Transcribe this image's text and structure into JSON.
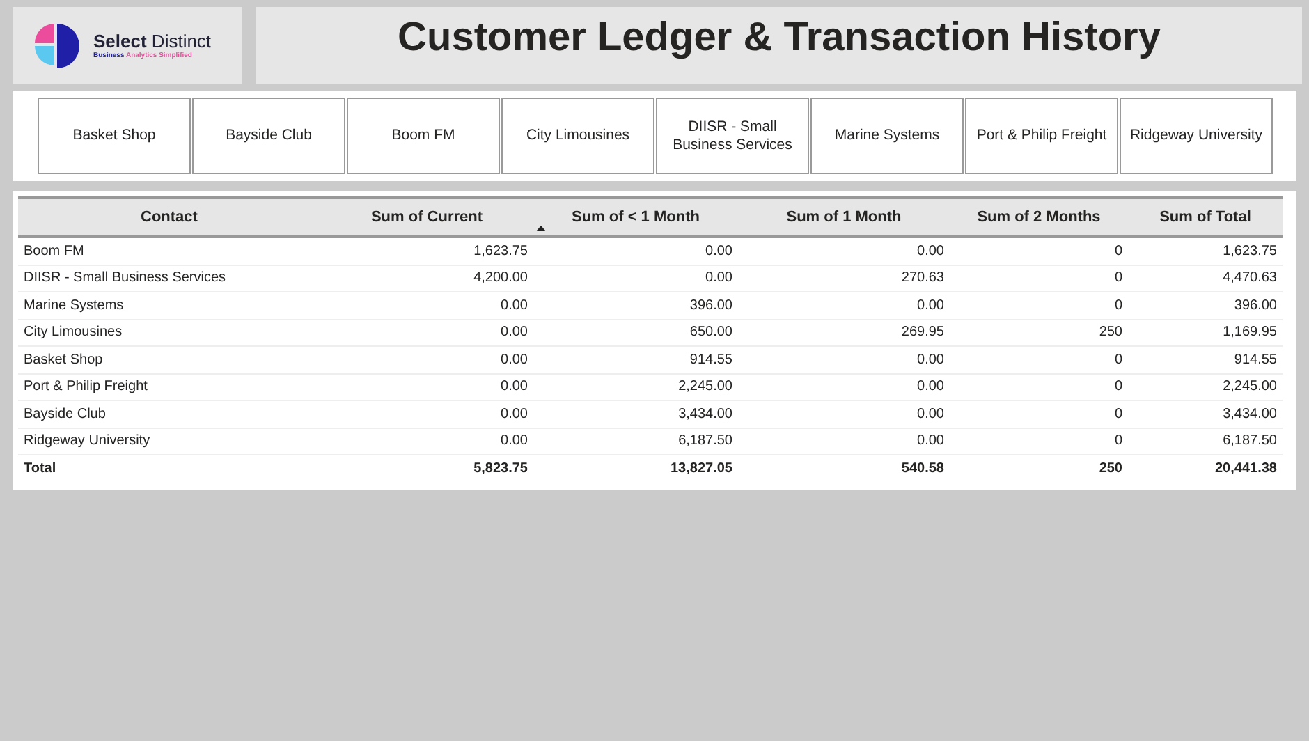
{
  "logo": {
    "name_bold": "Select",
    "name_rest": "Distinct",
    "tagline_a": "Business",
    "tagline_b": "Analytics Simplified"
  },
  "title": "Customer Ledger & Transaction History",
  "slicer": [
    "Basket Shop",
    "Bayside Club",
    "Boom FM",
    "City Limousines",
    "DIISR - Small Business Services",
    "Marine Systems",
    "Port & Philip Freight",
    "Ridgeway University"
  ],
  "table": {
    "columns": [
      {
        "label": "Contact",
        "sorted": false
      },
      {
        "label": "Sum of Current",
        "sorted": false
      },
      {
        "label": "Sum of < 1 Month",
        "sorted": true
      },
      {
        "label": "Sum of 1 Month",
        "sorted": false
      },
      {
        "label": "Sum of 2 Months",
        "sorted": false
      },
      {
        "label": "Sum of Total",
        "sorted": false
      }
    ],
    "rows": [
      [
        "Boom FM",
        "1,623.75",
        "0.00",
        "0.00",
        "0",
        "1,623.75"
      ],
      [
        "DIISR - Small Business Services",
        "4,200.00",
        "0.00",
        "270.63",
        "0",
        "4,470.63"
      ],
      [
        "Marine Systems",
        "0.00",
        "396.00",
        "0.00",
        "0",
        "396.00"
      ],
      [
        "City Limousines",
        "0.00",
        "650.00",
        "269.95",
        "250",
        "1,169.95"
      ],
      [
        "Basket Shop",
        "0.00",
        "914.55",
        "0.00",
        "0",
        "914.55"
      ],
      [
        "Port & Philip Freight",
        "0.00",
        "2,245.00",
        "0.00",
        "0",
        "2,245.00"
      ],
      [
        "Bayside Club",
        "0.00",
        "3,434.00",
        "0.00",
        "0",
        "3,434.00"
      ],
      [
        "Ridgeway University",
        "0.00",
        "6,187.50",
        "0.00",
        "0",
        "6,187.50"
      ]
    ],
    "total": [
      "Total",
      "5,823.75",
      "13,827.05",
      "540.58",
      "250",
      "20,441.38"
    ]
  }
}
